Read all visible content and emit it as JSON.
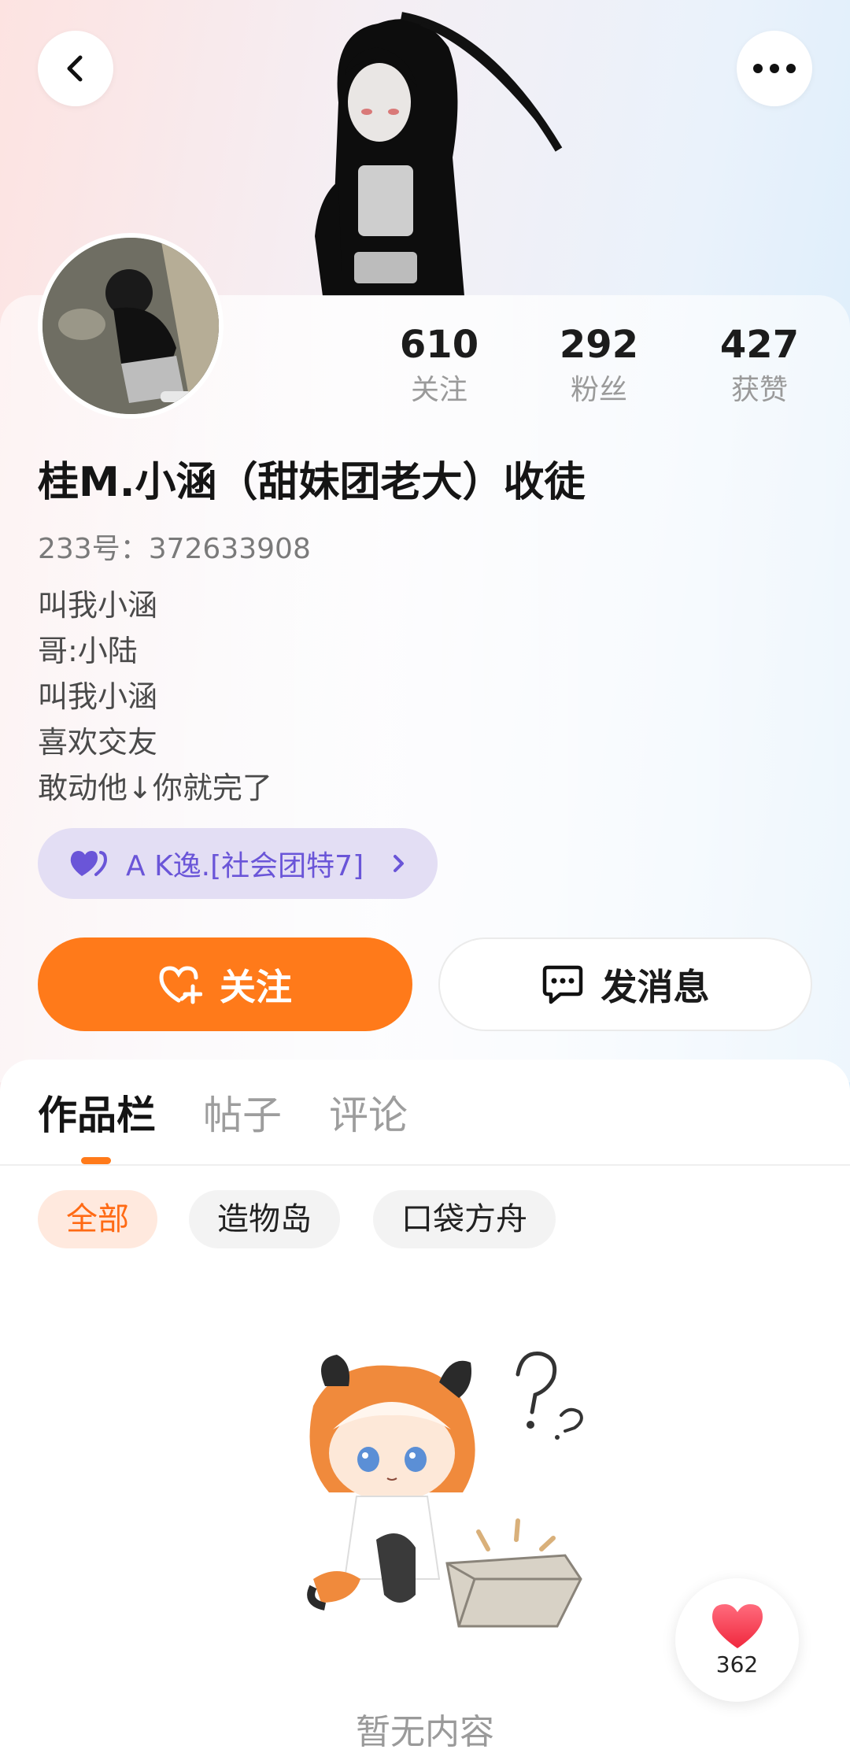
{
  "header": {
    "back_icon": "chevron-left-icon",
    "more_icon": "more-dots-icon"
  },
  "profile": {
    "stats": [
      {
        "value": "610",
        "label": "关注"
      },
      {
        "value": "292",
        "label": "粉丝"
      },
      {
        "value": "427",
        "label": "获赞"
      }
    ],
    "username": "桂M.小涵（甜妹团老大）收徒",
    "uid": "233号：372633908",
    "bio": [
      "叫我小涵",
      "哥:小陆",
      "叫我小涵",
      "喜欢交友",
      "敢动他↓你就完了"
    ],
    "relation_chip": {
      "label": "A K逸.[社会团特7]",
      "icon": "double-heart-icon",
      "color": "#6a55d8"
    },
    "follow_button": {
      "label": "关注",
      "icon": "heart-plus-icon"
    },
    "message_button": {
      "label": "发消息",
      "icon": "chat-bubble-icon"
    }
  },
  "tabs": [
    {
      "label": "作品栏",
      "active": true
    },
    {
      "label": "帖子",
      "active": false
    },
    {
      "label": "评论",
      "active": false
    }
  ],
  "filters": [
    {
      "label": "全部",
      "active": true
    },
    {
      "label": "造物岛",
      "active": false
    },
    {
      "label": "口袋方舟",
      "active": false
    }
  ],
  "empty_state": {
    "text": "暂无内容"
  },
  "like_fab": {
    "count": "362",
    "icon": "heart-icon"
  },
  "colors": {
    "accent": "#ff7a1a",
    "relation": "#6a55d8"
  }
}
